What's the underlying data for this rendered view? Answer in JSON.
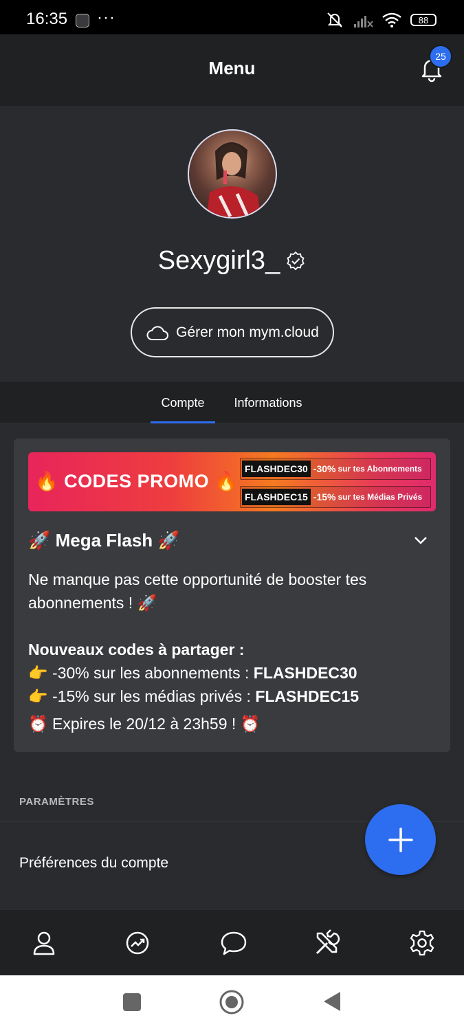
{
  "status_bar": {
    "time": "16:35",
    "dots": "···",
    "battery": "88",
    "icons": [
      "app-icon",
      "mute-icon",
      "signal-icon",
      "wifi-icon",
      "battery-icon"
    ]
  },
  "header": {
    "title": "Menu",
    "notification_count": "25",
    "accent": "#2d6df0"
  },
  "profile": {
    "username": "Sexygirl3_",
    "manage_button": "Gérer mon mym.cloud"
  },
  "tabs": [
    {
      "label": "Compte",
      "active": true
    },
    {
      "label": "Informations",
      "active": false
    }
  ],
  "promo": {
    "banner_title": "🔥 CODES PROMO 🔥",
    "codes": [
      {
        "code": "FLASHDEC30",
        "pct": "-30%",
        "text": "sur tes Abonnements"
      },
      {
        "code": "FLASHDEC15",
        "pct": "-15%",
        "text": "sur tes Médias Privés"
      }
    ],
    "title": "🚀 Mega Flash 🚀",
    "intro_1": "Ne manque pas cette opportunité de booster tes",
    "intro_2": "abonnements ! 🚀",
    "new_codes": "Nouveaux codes à partager :",
    "line1_prefix": "👉 -30% sur les abonnements : ",
    "line1_code": "FLASHDEC30",
    "line2_prefix": "👉 -15% sur les médias privés : ",
    "line2_code": "FLASHDEC15",
    "expiry": "⏰ Expires le 20/12 à 23h59 ! ⏰"
  },
  "settings": {
    "section_label": "PARAMÈTRES",
    "prefs_label": "Préférences du compte"
  },
  "bottom_nav": [
    "user-icon",
    "trending-icon",
    "chat-icon",
    "tools-icon",
    "gear-icon"
  ],
  "system_nav": [
    "square-icon",
    "home-circle-icon",
    "back-triangle-icon"
  ]
}
